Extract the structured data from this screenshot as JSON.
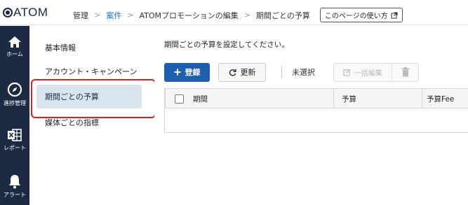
{
  "header": {
    "logo_text": "ATOM",
    "breadcrumbs": [
      "管理",
      "案件",
      "ATOMプロモーションの編集",
      "期間ごとの予算"
    ],
    "help_label": "このページの使い方"
  },
  "rail": {
    "items": [
      {
        "label": "ホーム",
        "icon": "home-icon"
      },
      {
        "label": "進捗管理",
        "icon": "compass-icon"
      },
      {
        "label": "レポート",
        "icon": "excel-report-icon"
      },
      {
        "label": "アラート",
        "icon": "bell-icon"
      }
    ]
  },
  "subnav": {
    "items": [
      {
        "label": "基本情報"
      },
      {
        "label": "アカウント・キャンペーン"
      },
      {
        "label": "期間ごとの予算",
        "active": true
      },
      {
        "label": "媒体ごとの指標"
      }
    ]
  },
  "main": {
    "description": "期間ごとの予算を設定してください。",
    "toolbar": {
      "register_label": "登録",
      "refresh_label": "更新",
      "selection_label": "未選択",
      "bulk_edit_label": "一括編集"
    },
    "table": {
      "columns": [
        "期間",
        "予算",
        "予算Fee"
      ]
    }
  },
  "colors": {
    "rail_bg": "#1d2a44",
    "primary": "#1f5faf",
    "active_bg": "#d9e4ef",
    "highlight": "#e0201b",
    "link": "#1a73c9"
  }
}
